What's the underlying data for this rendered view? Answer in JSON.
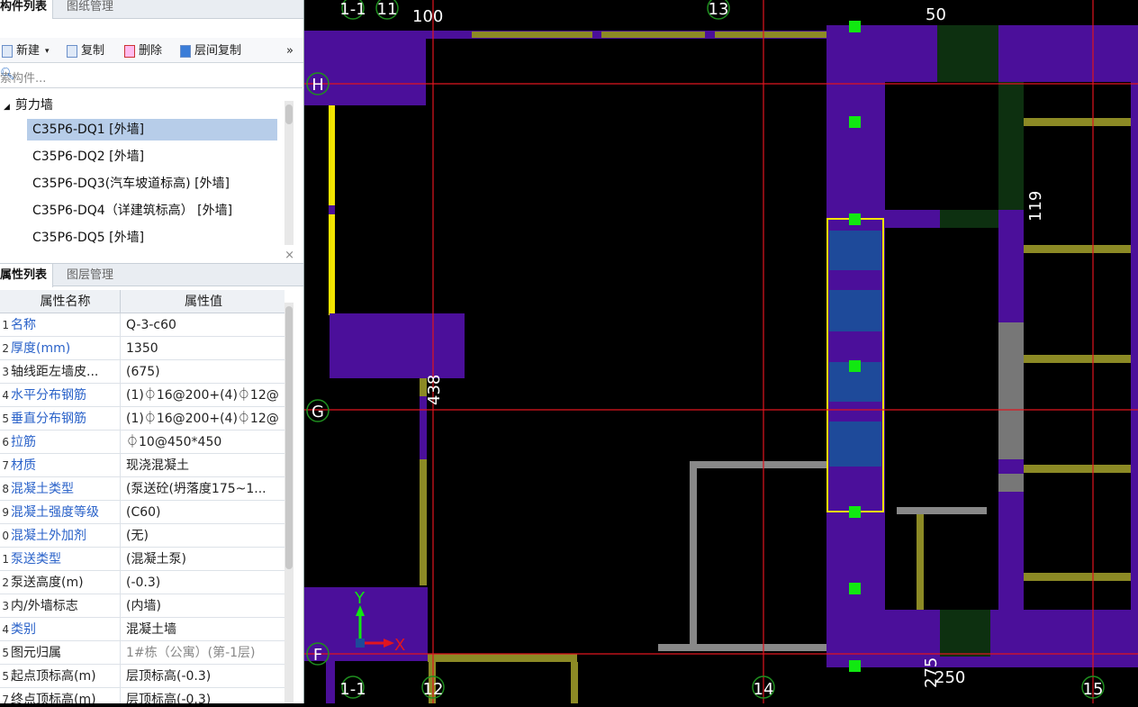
{
  "component_panel": {
    "tabs": [
      "构件列表",
      "图纸管理"
    ],
    "close": "×",
    "toolbar": {
      "new": "新建",
      "copy": "复制",
      "delete": "删除",
      "floor_copy": "层间复制",
      "more": "»"
    },
    "search_placeholder": "索构件...",
    "tree_root": "剪力墙",
    "items": [
      "C35P6-DQ1 [外墙]",
      "C35P6-DQ2 [外墙]",
      "C35P6-DQ3(汽车坡道标高) [外墙]",
      "C35P6-DQ4（详建筑标高） [外墙]",
      "C35P6-DQ5 [外墙]"
    ],
    "selected_index": 0
  },
  "property_panel": {
    "tabs": [
      "属性列表",
      "图层管理"
    ],
    "close": "×",
    "headers": {
      "name": "属性名称",
      "value": "属性值"
    },
    "rows": [
      {
        "idx": "1",
        "name": "名称",
        "value": "Q-3-c60",
        "blue": true
      },
      {
        "idx": "2",
        "name": "厚度(mm)",
        "value": "1350",
        "blue": true
      },
      {
        "idx": "3",
        "name": "轴线距左墙皮...",
        "value": "(675)",
        "blue": false
      },
      {
        "idx": "4",
        "name": "水平分布钢筋",
        "value": "(1)⏀16@200+(4)⏀12@",
        "blue": true
      },
      {
        "idx": "5",
        "name": "垂直分布钢筋",
        "value": "(1)⏀16@200+(4)⏀12@",
        "blue": true
      },
      {
        "idx": "6",
        "name": "拉筋",
        "value": "⏀10@450*450",
        "blue": true
      },
      {
        "idx": "7",
        "name": "材质",
        "value": "现浇混凝土",
        "blue": true
      },
      {
        "idx": "8",
        "name": "混凝土类型",
        "value": "(泵送砼(坍落度175~1...",
        "blue": true
      },
      {
        "idx": "9",
        "name": "混凝土强度等级",
        "value": "(C60)",
        "blue": true
      },
      {
        "idx": "0",
        "name": "混凝土外加剂",
        "value": "(无)",
        "blue": true
      },
      {
        "idx": "1",
        "name": "泵送类型",
        "value": "(混凝土泵)",
        "blue": true
      },
      {
        "idx": "2",
        "name": "泵送高度(m)",
        "value": "(-0.3)",
        "blue": false
      },
      {
        "idx": "3",
        "name": "内/外墙标志",
        "value": "(内墙)",
        "blue": false
      },
      {
        "idx": "4",
        "name": "类别",
        "value": "混凝土墙",
        "blue": true
      },
      {
        "idx": "5",
        "name": "图元归属",
        "value": "1#栋（公寓）(第-1层)",
        "blue": false,
        "grey": true
      },
      {
        "idx": "5",
        "name": "起点顶标高(m)",
        "value": "层顶标高(-0.3)",
        "blue": false
      },
      {
        "idx": "7",
        "name": "终点顶标高(m)",
        "value": "层顶标高(-0.3)",
        "blue": false
      }
    ]
  },
  "canvas": {
    "axis_x_labels": [
      "1-1",
      "11",
      "13",
      "1-1",
      "12",
      "14",
      "15"
    ],
    "axis_y_labels": [
      "H",
      "G",
      "F"
    ],
    "dimensions": [
      "100",
      "50",
      "119",
      "438",
      "275",
      "250"
    ],
    "coord_x": "X",
    "coord_y": "Y"
  },
  "colors": {
    "wall_purple": "#4b0f9a",
    "dark_green": "#0d3010",
    "olive_beam": "#8c8a25",
    "axis_red": "#e0151f",
    "selected_blue": "#1e4a9a",
    "point_green": "#11e811",
    "select_yellow": "#f2e400"
  }
}
